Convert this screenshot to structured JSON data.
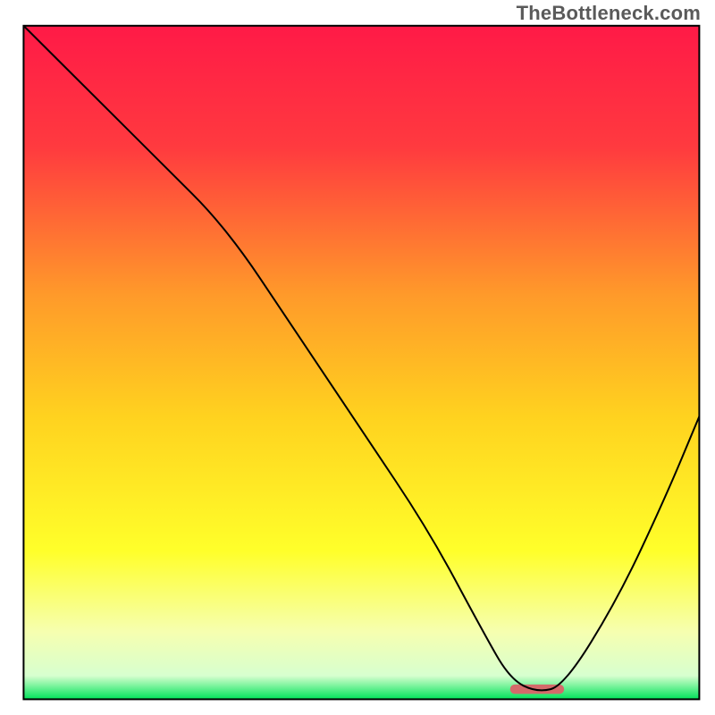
{
  "watermark": "TheBottleneck.com",
  "chart_data": {
    "type": "line",
    "title": "",
    "xlabel": "",
    "ylabel": "",
    "xlim": [
      0,
      100
    ],
    "ylim": [
      0,
      100
    ],
    "grid": false,
    "legend": false,
    "background_gradient_stops": [
      {
        "offset": 0.0,
        "color": "#ff1a47"
      },
      {
        "offset": 0.18,
        "color": "#ff3a3f"
      },
      {
        "offset": 0.4,
        "color": "#ff9a2a"
      },
      {
        "offset": 0.58,
        "color": "#ffd21f"
      },
      {
        "offset": 0.78,
        "color": "#ffff2a"
      },
      {
        "offset": 0.9,
        "color": "#f6ffb0"
      },
      {
        "offset": 0.965,
        "color": "#d7ffcf"
      },
      {
        "offset": 1.0,
        "color": "#00e35a"
      }
    ],
    "series": [
      {
        "name": "bottleneck-curve",
        "color": "#000000",
        "stroke_width": 2,
        "x": [
          0,
          10,
          20,
          30,
          40,
          50,
          60,
          68,
          72,
          76,
          80,
          88,
          95,
          100
        ],
        "values": [
          100,
          90,
          80,
          70,
          55,
          40,
          25,
          10,
          3,
          1,
          2,
          15,
          30,
          42
        ]
      }
    ],
    "marker": {
      "name": "optimal-zone",
      "x_start": 72,
      "x_end": 80,
      "y": 1.5,
      "color": "#d46a6a",
      "thickness_pct": 1.4
    },
    "axes": {
      "frame_color": "#000000",
      "frame_width": 2,
      "inset_left_pct": 3.3,
      "inset_right_pct": 2.2,
      "inset_top_pct": 3.6,
      "inset_bottom_pct": 2.2
    }
  }
}
